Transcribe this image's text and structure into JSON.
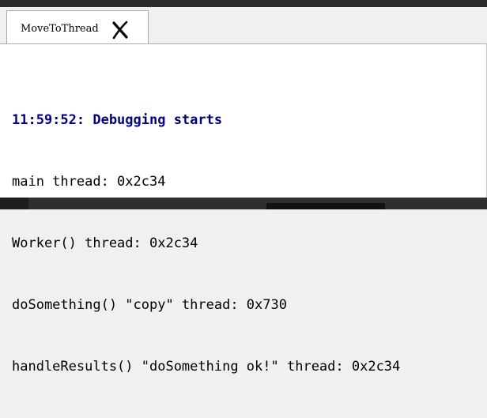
{
  "tab": {
    "label": "MoveToThread",
    "close_icon": "close-x-icon"
  },
  "console": {
    "lines": [
      "11:59:52: Debugging starts",
      "main thread: 0x2c34",
      "Worker() thread: 0x2c34",
      "doSomething() \"copy\" thread: 0x730",
      "handleResults() \"doSomething ok!\" thread: 0x2c34"
    ]
  },
  "colors": {
    "header_text": "#000080",
    "background": "#ffffff",
    "chrome": "#f0f0f0"
  }
}
